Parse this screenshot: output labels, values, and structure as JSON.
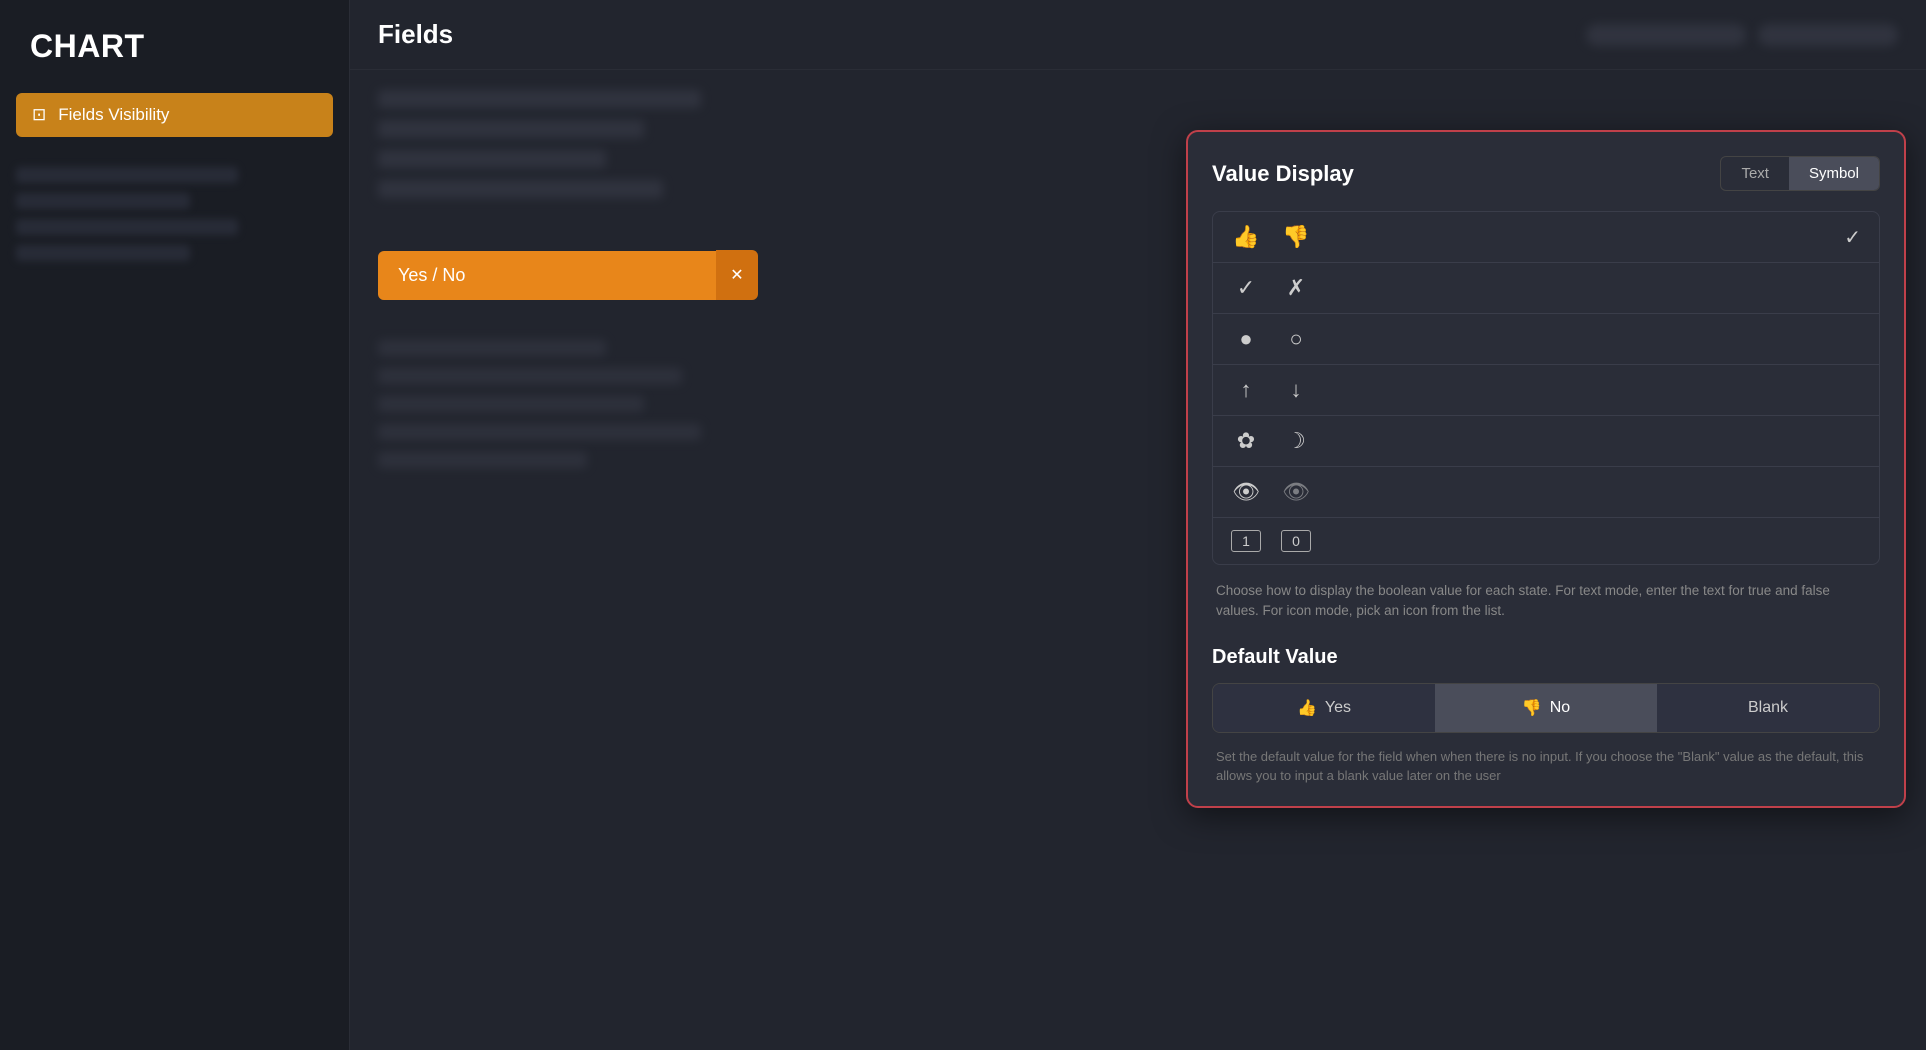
{
  "sidebar": {
    "title": "CHART",
    "nav": {
      "active_item": {
        "label": "Fields Visibility",
        "icon": "monitor-icon"
      }
    }
  },
  "header": {
    "title": "Fields",
    "blurred_left": "blurred content",
    "blurred_right": "blurred content"
  },
  "yesno_field": {
    "label": "Yes / No",
    "clear_btn_icon": "✕"
  },
  "panel": {
    "title": "Value Display",
    "toggle": {
      "text_label": "Text",
      "symbol_label": "Symbol",
      "active": "Symbol"
    },
    "symbol_rows": [
      {
        "true_sym": "👍",
        "false_sym": "👎",
        "selected": true
      },
      {
        "true_sym": "✓",
        "false_sym": "✗",
        "selected": false
      },
      {
        "true_sym": "●",
        "false_sym": "○",
        "selected": false
      },
      {
        "true_sym": "↑",
        "false_sym": "↓",
        "selected": false
      },
      {
        "true_sym": "☀",
        "false_sym": "☽",
        "selected": false
      },
      {
        "true_sym": "👁",
        "false_sym": "👁‍🗨",
        "selected": false
      },
      {
        "true_sym": "1",
        "false_sym": "0",
        "selected": false
      }
    ],
    "description": "Choose how to display the boolean value for each state. For text mode, enter the text for true and false values. For icon mode, pick an icon from the list.",
    "default_value": {
      "title": "Default Value",
      "yes_label": "Yes",
      "no_label": "No",
      "blank_label": "Blank",
      "active": "No"
    },
    "bottom_description": "Set the default value for the field when when there is no input. If you choose the \"Blank\" value as the default, this allows you to input a blank value later on the user"
  }
}
